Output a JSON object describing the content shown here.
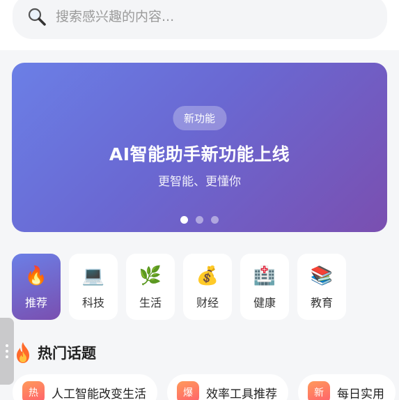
{
  "search": {
    "placeholder": "搜索感兴趣的内容...",
    "icon": "search-icon"
  },
  "banner": {
    "badge": "新功能",
    "title": "AI智能助手新功能上线",
    "subtitle": "更智能、更懂你",
    "slide_count": 3,
    "active_slide": 1,
    "gradient": [
      "#6b7fe6",
      "#7a4fb0"
    ]
  },
  "categories": [
    {
      "label": "推荐",
      "icon": "fire-icon",
      "glyph": "🔥",
      "active": true
    },
    {
      "label": "科技",
      "icon": "laptop-icon",
      "glyph": "💻",
      "active": false
    },
    {
      "label": "生活",
      "icon": "herb-icon",
      "glyph": "🌿",
      "active": false
    },
    {
      "label": "财经",
      "icon": "money-bag-icon",
      "glyph": "💰",
      "active": false
    },
    {
      "label": "健康",
      "icon": "hospital-icon",
      "glyph": "🏥",
      "active": false
    },
    {
      "label": "教育",
      "icon": "books-icon",
      "glyph": "📚",
      "active": false
    }
  ],
  "hot_section": {
    "title": "热门话题",
    "icon": "fire-icon"
  },
  "topics": [
    {
      "tag": "热",
      "label": "人工智能改变生活"
    },
    {
      "tag": "爆",
      "label": "效率工具推荐"
    },
    {
      "tag": "新",
      "label": "每日实用"
    }
  ],
  "colors": {
    "accent": "#6b7fe6",
    "accent_end": "#7a4fb0",
    "tag": "#ff7a5c",
    "background": "#f5f6f8"
  }
}
